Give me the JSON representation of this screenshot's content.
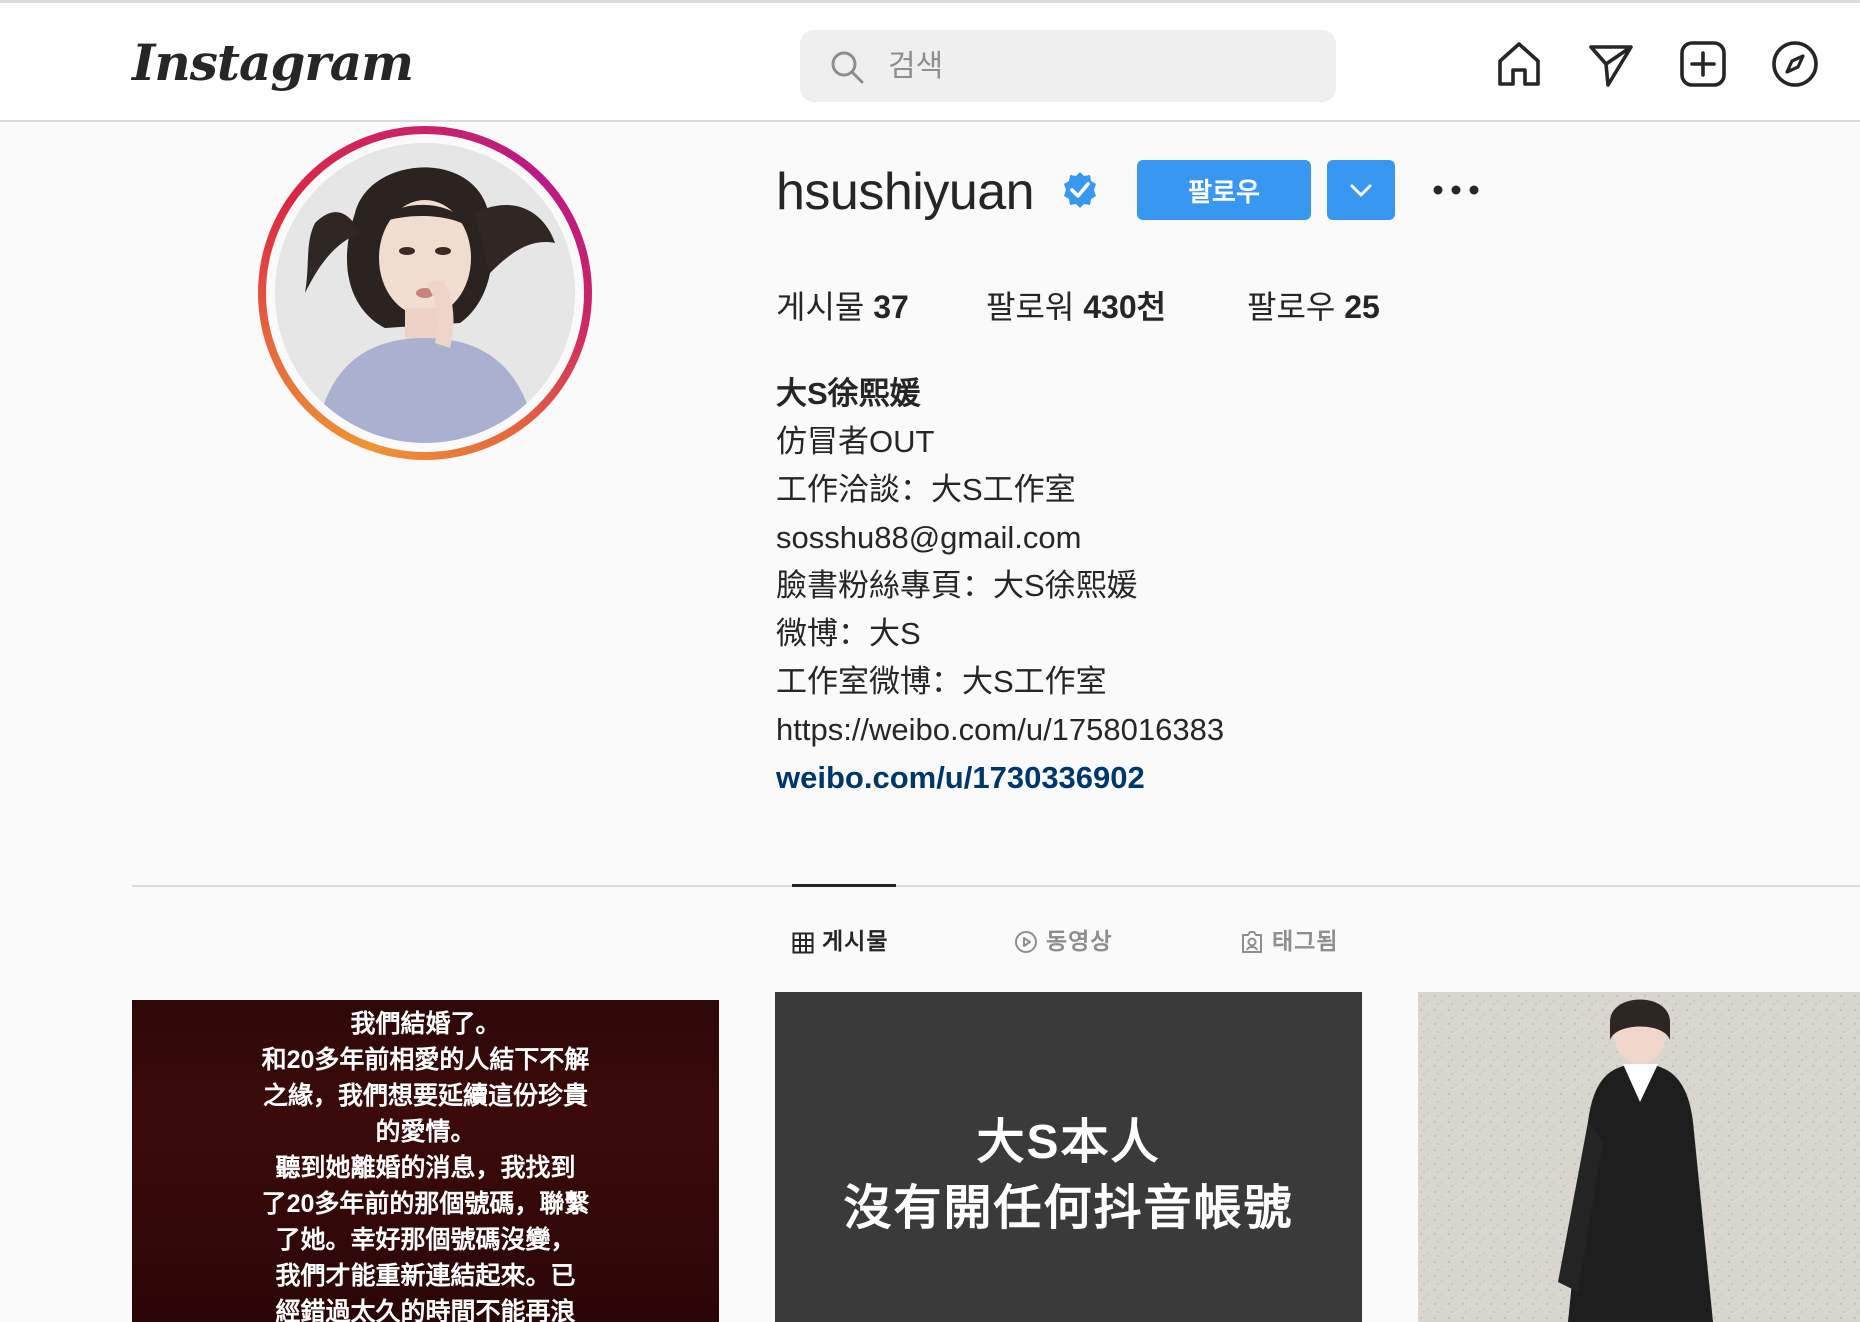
{
  "header": {
    "logo_text": "Instagram",
    "search": {
      "placeholder": "검색",
      "value": ""
    },
    "nav_icons": [
      "home-icon",
      "direct-message-icon",
      "new-post-icon",
      "explore-icon"
    ]
  },
  "profile": {
    "username": "hsushiyuan",
    "verified": true,
    "follow_label": "팔로우",
    "stats": {
      "posts_label": "게시물",
      "posts_count": "37",
      "followers_label": "팔로워",
      "followers_count": "430천",
      "following_label": "팔로우",
      "following_count": "25"
    },
    "bio": {
      "name": "大S徐熙媛",
      "lines": [
        "仿冒者OUT",
        "工作洽談：大S工作室",
        "sosshu88@gmail.com",
        "臉書粉絲專頁：大S徐熙媛",
        "微博：大S",
        "工作室微博：大S工作室",
        "https://weibo.com/u/1758016383"
      ],
      "link": "weibo.com/u/1730336902"
    }
  },
  "tabs": [
    {
      "label": "게시물",
      "icon": "grid-icon",
      "active": true
    },
    {
      "label": "동영상",
      "icon": "video-play-icon",
      "active": false
    },
    {
      "label": "태그됨",
      "icon": "tagged-user-icon",
      "active": false
    }
  ],
  "posts": [
    {
      "text_lines": [
        "我們結婚了。",
        "和20多年前相愛的人結下不解",
        "之緣，我們想要延續這份珍貴",
        "的愛情。",
        "聽到她離婚的消息，我找到",
        "了20多年前的那個號碼，聯繫",
        "了她。幸好那個號碼沒變，",
        "我們才能重新連結起來。已",
        "經錯過太久的時間不能再浪"
      ]
    },
    {
      "text_lines": [
        "大S本人",
        "沒有開任何抖音帳號"
      ]
    },
    {
      "text_lines": []
    }
  ],
  "colors": {
    "accent_blue": "#3897f0",
    "link_blue": "#00376b",
    "verified_blue": "#3897f0",
    "text_primary": "#262626",
    "text_secondary": "#8e8e8e"
  }
}
